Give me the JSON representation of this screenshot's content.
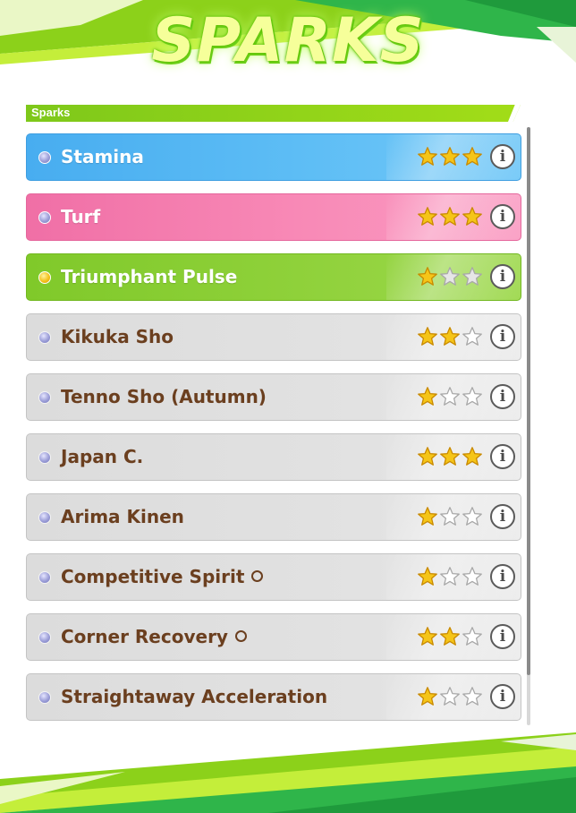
{
  "title": "SPARKS",
  "section_label": "Sparks",
  "colors": {
    "blue": "#5dbdf5",
    "pink": "#f889b6",
    "green": "#8fd13a",
    "white": "#e2e2e2",
    "star_filled": "#f5c518",
    "name_text": "#6b3f1f"
  },
  "sparks": [
    {
      "name": "Stamina",
      "type": "blue",
      "stars": 3,
      "dot": "blue",
      "circle": false
    },
    {
      "name": "Turf",
      "type": "pink",
      "stars": 3,
      "dot": "blue",
      "circle": false
    },
    {
      "name": "Triumphant Pulse",
      "type": "green",
      "stars": 1,
      "dot": "gold",
      "circle": false
    },
    {
      "name": "Kikuka Sho",
      "type": "white",
      "stars": 2,
      "dot": "blue",
      "circle": false
    },
    {
      "name": "Tenno Sho (Autumn)",
      "type": "white",
      "stars": 1,
      "dot": "blue",
      "circle": false
    },
    {
      "name": "Japan C.",
      "type": "white",
      "stars": 3,
      "dot": "blue",
      "circle": false
    },
    {
      "name": "Arima Kinen",
      "type": "white",
      "stars": 1,
      "dot": "blue",
      "circle": false
    },
    {
      "name": "Competitive Spirit",
      "type": "white",
      "stars": 1,
      "dot": "blue",
      "circle": true
    },
    {
      "name": "Corner Recovery",
      "type": "white",
      "stars": 2,
      "dot": "blue",
      "circle": true
    },
    {
      "name": "Straightaway Acceleration",
      "type": "white",
      "stars": 1,
      "dot": "blue",
      "circle": false
    }
  ],
  "info_glyph": "i",
  "scroll_position": 0.0
}
